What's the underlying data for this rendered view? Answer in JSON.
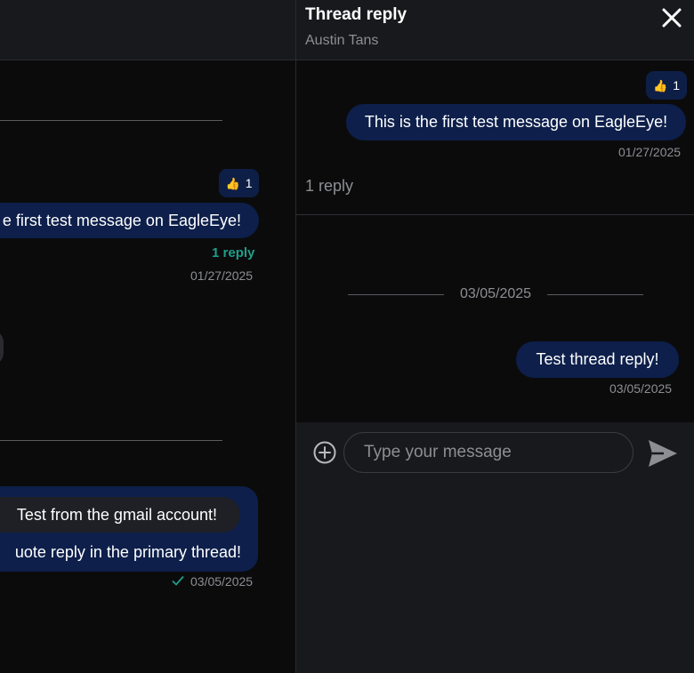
{
  "main": {
    "message1": {
      "text": "e first test message on EagleEye!",
      "reaction_emoji": "👍",
      "reaction_count": "1",
      "reply_link": "1 reply",
      "timestamp": "01/27/2025"
    },
    "message2": {
      "quoted_text": "Test from the gmail account!",
      "text": "uote reply in the primary thread!",
      "timestamp": "03/05/2025",
      "status_icon": "check-icon"
    }
  },
  "thread": {
    "title": "Thread reply",
    "author": "Austin Tans",
    "close_icon": "close-icon",
    "root": {
      "text": "This is the first test message on EagleEye!",
      "reaction_emoji": "👍",
      "reaction_count": "1",
      "timestamp": "01/27/2025",
      "reply_count": "1 reply"
    },
    "date_separator": "03/05/2025",
    "replies": [
      {
        "text": "Test thread reply!",
        "timestamp": "03/05/2025"
      }
    ],
    "composer": {
      "placeholder": "Type your message",
      "add_icon": "plus-circle-icon",
      "send_icon": "send-icon"
    }
  },
  "colors": {
    "bubble": "#0d1f4a",
    "accent_reply": "#1f9e8a",
    "background": "#0b0b0c",
    "panel": "#18191c"
  }
}
